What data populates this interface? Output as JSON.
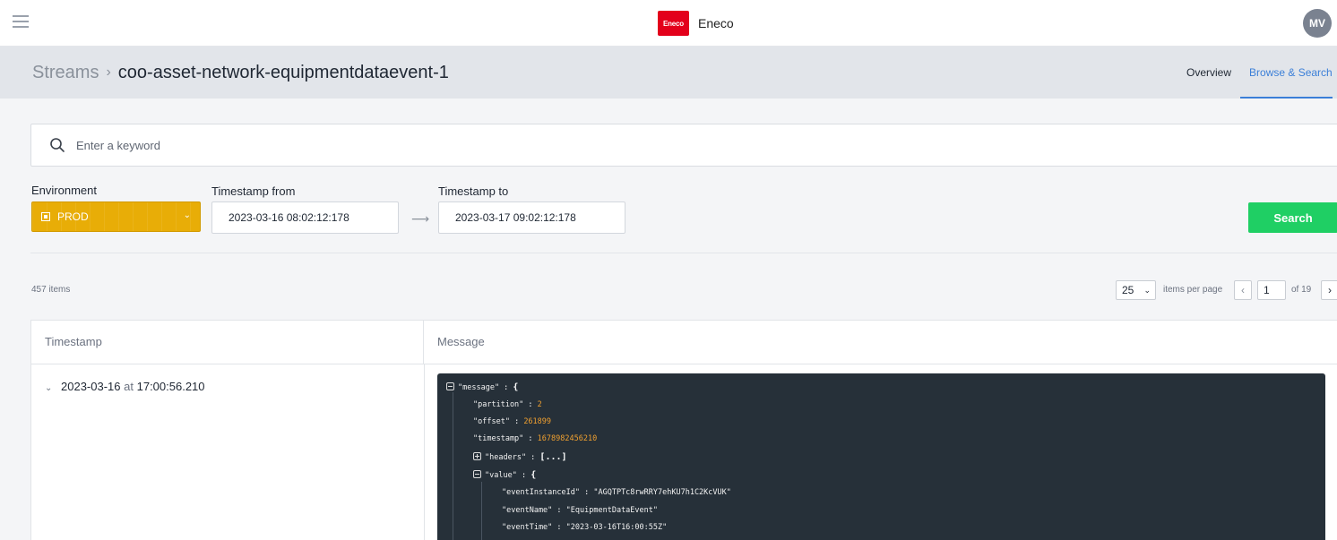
{
  "app": {
    "brand_name": "Eneco",
    "brand_logo_text": "Eneco",
    "avatar_initials": "MV"
  },
  "header": {
    "breadcrumb_root": "Streams",
    "breadcrumb_current": "coo-asset-network-equipmentdataevent-1",
    "tabs": [
      {
        "label": "Overview",
        "active": false
      },
      {
        "label": "Browse & Search",
        "active": true
      }
    ]
  },
  "search": {
    "placeholder": "Enter a keyword",
    "value": "",
    "button_label": "Search"
  },
  "filters": {
    "environment_label": "Environment",
    "environment_value": "PROD",
    "timestamp_from_label": "Timestamp from",
    "timestamp_from_value": "2023-03-16 08:02:12:178",
    "timestamp_to_label": "Timestamp to",
    "timestamp_to_value": "2023-03-17 09:02:12:178"
  },
  "pagination": {
    "item_count": "457 items",
    "per_page_value": "25",
    "per_page_label": "items per page",
    "current_page": "1",
    "total_pages": "of 19"
  },
  "table": {
    "columns": [
      "Timestamp",
      "Message"
    ],
    "rows": [
      {
        "date": "2023-03-16",
        "at": "at",
        "time": "17:00:56.210"
      }
    ]
  },
  "message_json": {
    "root_key": "\"message\"",
    "partition_key": "\"partition\"",
    "partition_value": "2",
    "offset_key": "\"offset\"",
    "offset_value": "261899",
    "timestamp_key": "\"timestamp\"",
    "timestamp_value": "1678982456210",
    "headers_key": "\"headers\"",
    "headers_collapsed": "[...]",
    "value_key": "\"value\"",
    "event_instance_id_key": "\"eventInstanceId\"",
    "event_instance_id_value": "\"AGQTPTc8rwRRY7ehKU7h1C2KcVUK\"",
    "event_name_key": "\"eventName\"",
    "event_name_value": "\"EquipmentDataEvent\"",
    "event_time_key": "\"eventTime\"",
    "event_time_value": "\"2023-03-16T16:00:55Z\""
  },
  "colors": {
    "accent": "#3b7fd8",
    "environment_prod": "#e8ad07",
    "search_button": "#1fcf64",
    "brand": "#e3001b",
    "json_background": "#263039",
    "json_number": "#f0a030"
  },
  "icons": {
    "menu": "hamburger-icon",
    "search": "search-icon",
    "arrow": "arrow-right-icon",
    "expand": "chevron-down-icon"
  }
}
